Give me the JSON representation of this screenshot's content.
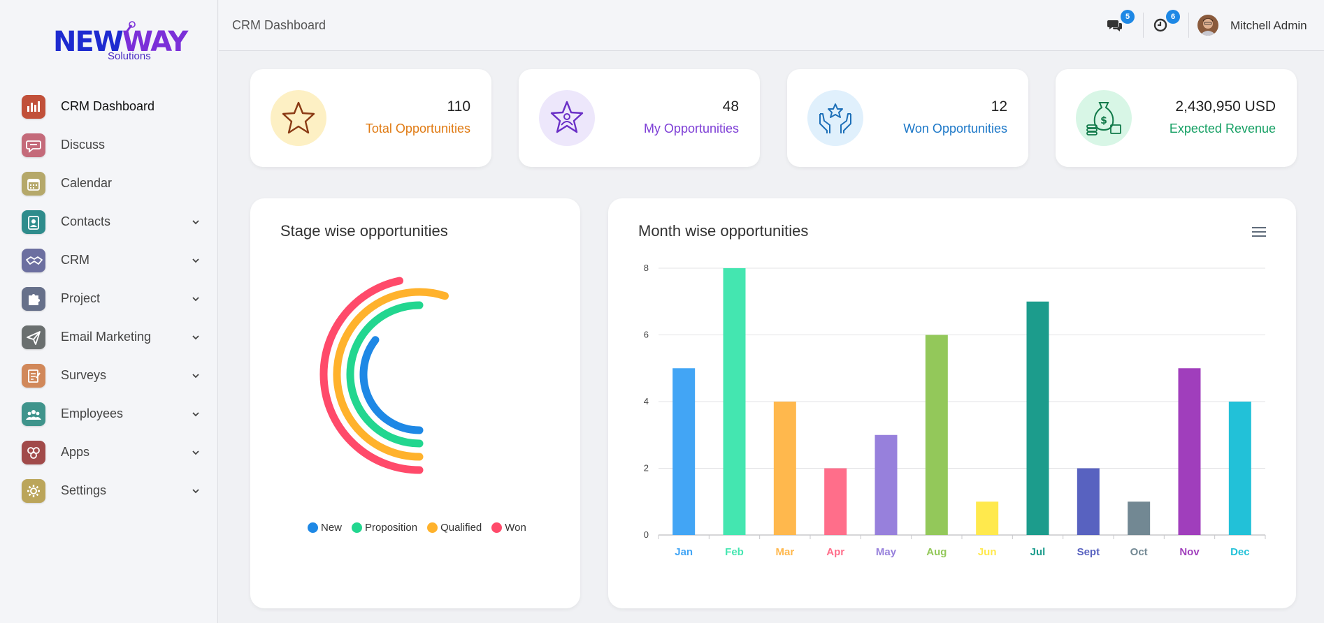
{
  "brand": {
    "name_part1": "NEW",
    "name_part2": "AY",
    "sub": "Solutions"
  },
  "sidebar": {
    "items": [
      {
        "label": "CRM Dashboard",
        "icon": "bar-chart-icon",
        "color": "#c1503a",
        "active": true,
        "has_chevron": false
      },
      {
        "label": "Discuss",
        "icon": "chat-bubble-icon",
        "color": "#c46a7a",
        "active": false,
        "has_chevron": false
      },
      {
        "label": "Calendar",
        "icon": "calendar-icon",
        "color": "#b5a86a",
        "active": false,
        "has_chevron": false
      },
      {
        "label": "Contacts",
        "icon": "contact-card-icon",
        "color": "#2e8c8c",
        "active": false,
        "has_chevron": true
      },
      {
        "label": "CRM",
        "icon": "handshake-icon",
        "color": "#6c6fa0",
        "active": false,
        "has_chevron": true
      },
      {
        "label": "Project",
        "icon": "puzzle-icon",
        "color": "#66708a",
        "active": false,
        "has_chevron": true
      },
      {
        "label": "Email Marketing",
        "icon": "paper-plane-icon",
        "color": "#6a6f6f",
        "active": false,
        "has_chevron": true
      },
      {
        "label": "Surveys",
        "icon": "survey-icon",
        "color": "#d1885a",
        "active": false,
        "has_chevron": true
      },
      {
        "label": "Employees",
        "icon": "people-icon",
        "color": "#3f948c",
        "active": false,
        "has_chevron": true
      },
      {
        "label": "Apps",
        "icon": "apps-icon",
        "color": "#a14a4a",
        "active": false,
        "has_chevron": true
      },
      {
        "label": "Settings",
        "icon": "gear-icon",
        "color": "#bba55a",
        "active": false,
        "has_chevron": true
      }
    ]
  },
  "topbar": {
    "title": "CRM Dashboard",
    "messages_badge": "5",
    "activities_badge": "6",
    "user_name": "Mitchell Admin"
  },
  "kpis": [
    {
      "value": "110",
      "label": "Total Opportunities",
      "label_color": "#e07b14",
      "bg": "#fdf0c4",
      "icon": "star-icon",
      "icon_color": "#8a3a14"
    },
    {
      "value": "48",
      "label": "My Opportunities",
      "label_color": "#7e3fd6",
      "bg": "#ede7fb",
      "icon": "star-person-icon",
      "icon_color": "#6a2fc6"
    },
    {
      "value": "12",
      "label": "Won Opportunities",
      "label_color": "#1d78c8",
      "bg": "#e0f0fc",
      "icon": "hands-star-icon",
      "icon_color": "#1d6fb8"
    },
    {
      "value": "2,430,950 USD",
      "label": "Expected Revenue",
      "label_color": "#16a064",
      "bg": "#d8f6e6",
      "icon": "money-bag-icon",
      "icon_color": "#127a4a"
    }
  ],
  "stage_panel": {
    "title": "Stage wise opportunities",
    "legend": [
      {
        "label": "New",
        "color": "#1e88e5"
      },
      {
        "label": "Proposition",
        "color": "#22d68f"
      },
      {
        "label": "Qualified",
        "color": "#ffb22c"
      },
      {
        "label": "Won",
        "color": "#ff4a6a"
      }
    ]
  },
  "month_panel": {
    "title": "Month wise opportunities"
  },
  "chart_data": [
    {
      "type": "radialBar",
      "series": [
        {
          "name": "New",
          "color": "#1e88e5"
        },
        {
          "name": "Proposition",
          "color": "#22d68f"
        },
        {
          "name": "Qualified",
          "color": "#ffb22c"
        },
        {
          "name": "Won",
          "color": "#ff4a6a"
        }
      ],
      "legend_position": "bottom"
    },
    {
      "type": "bar",
      "categories": [
        "Jan",
        "Feb",
        "Mar",
        "Apr",
        "May",
        "Aug",
        "Jun",
        "Jul",
        "Sept",
        "Oct",
        "Nov",
        "Dec"
      ],
      "values": [
        5,
        8,
        4,
        2,
        3,
        6,
        1,
        7,
        2,
        1,
        5,
        4
      ],
      "colors": [
        "#42a5f5",
        "#44e6b0",
        "#ffb84d",
        "#ff6e8a",
        "#9780dc",
        "#93c85a",
        "#ffe94d",
        "#1c9c8c",
        "#5862c0",
        "#728893",
        "#a03ebc",
        "#22c1d8"
      ],
      "yticks": [
        "0",
        "2",
        "4",
        "6",
        "8"
      ],
      "ylim": [
        0,
        8
      ],
      "grid": true,
      "legend": false
    }
  ]
}
